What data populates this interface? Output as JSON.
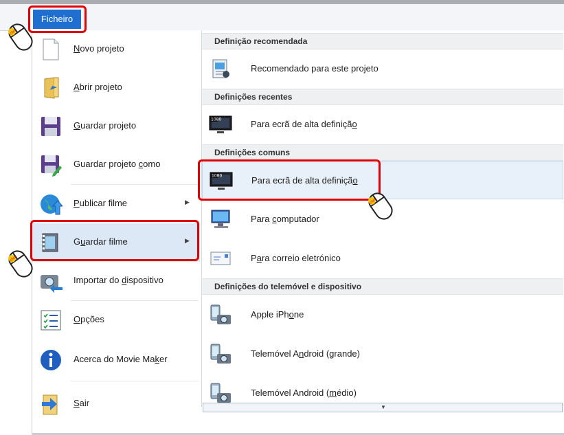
{
  "file_tab": {
    "label": "Ficheiro"
  },
  "left_menu": {
    "items": [
      {
        "name": "novo-projeto",
        "pre": "",
        "ul": "N",
        "post": "ovo projeto",
        "icon": "new-project-icon"
      },
      {
        "name": "abrir-projeto",
        "pre": "",
        "ul": "A",
        "post": "brir projeto",
        "icon": "open-folder-icon"
      },
      {
        "name": "guardar-projeto",
        "pre": "",
        "ul": "G",
        "post": "uardar projeto",
        "icon": "floppy-disk-icon"
      },
      {
        "name": "guardar-projeto-como",
        "pre": "Guardar projeto ",
        "ul": "c",
        "post": "omo",
        "icon": "floppy-save-as-icon"
      },
      {
        "name": "publicar-filme",
        "pre": "",
        "ul": "P",
        "post": "ublicar filme",
        "icon": "globe-upload-icon",
        "submenu": true
      },
      {
        "name": "guardar-filme",
        "pre": "G",
        "ul": "u",
        "post": "ardar filme",
        "icon": "film-save-icon",
        "submenu": true
      },
      {
        "name": "importar-do-dispositivo",
        "pre": "Importar do ",
        "ul": "d",
        "post": "ispositivo",
        "icon": "camera-import-icon"
      },
      {
        "name": "opcoes",
        "pre": "",
        "ul": "O",
        "post": "pções",
        "icon": "options-list-icon"
      },
      {
        "name": "acerca",
        "pre": "Acerca do Movie Ma",
        "ul": "k",
        "post": "er",
        "icon": "info-icon"
      },
      {
        "name": "sair",
        "pre": "",
        "ul": "S",
        "post": "air",
        "icon": "exit-icon"
      }
    ]
  },
  "right_menu": {
    "sections": [
      {
        "header": "Definição recomendada",
        "items": [
          {
            "pre": "Recomendado para este projeto",
            "ul": "",
            "post": "",
            "icon": "recommended-settings-icon"
          }
        ]
      },
      {
        "header": "Definições recentes",
        "items": [
          {
            "pre": "Para ecrã de alta definiçã",
            "ul": "o",
            "post": "",
            "icon": "hd-1080-display-icon"
          }
        ]
      },
      {
        "header": "Definições comuns",
        "items": [
          {
            "pre": "Para ecrã de alta definiçã",
            "ul": "o",
            "post": "",
            "icon": "hd-1080-display-icon"
          },
          {
            "pre": "Para ",
            "ul": "c",
            "post": "omputador",
            "icon": "computer-monitor-icon"
          },
          {
            "pre": "P",
            "ul": "a",
            "post": "ra correio eletrónico",
            "icon": "email-envelope-icon"
          }
        ]
      },
      {
        "header": "Definições do telemóvel e dispositivo",
        "items": [
          {
            "pre": "Apple iPh",
            "ul": "o",
            "post": "ne",
            "icon": "phone-camera-icon"
          },
          {
            "pre": "Telemóvel A",
            "ul": "n",
            "post": "droid (grande)",
            "icon": "phone-camera-icon"
          },
          {
            "pre": "Telemóvel Android (",
            "ul": "m",
            "post": "édio)",
            "icon": "phone-camera-icon"
          }
        ]
      }
    ]
  },
  "annotations": {
    "mouse_text": "click",
    "highlight_color": "#e00000"
  }
}
